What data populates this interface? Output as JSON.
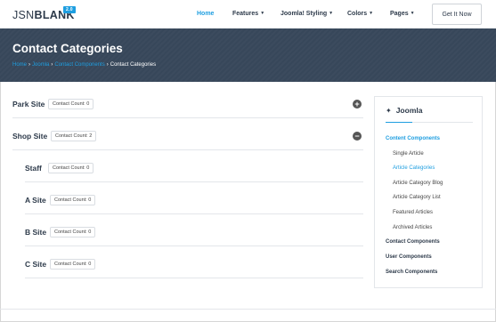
{
  "header": {
    "logo_main": "JSN",
    "logo_bold": "BLANK",
    "logo_version": "2.0",
    "nav": [
      {
        "label": "Home",
        "active": true,
        "has_caret": false
      },
      {
        "label": "Features",
        "active": false,
        "has_caret": true
      },
      {
        "label": "Joomla! Styling",
        "active": false,
        "has_caret": true
      },
      {
        "label": "Colors",
        "active": false,
        "has_caret": true
      },
      {
        "label": "Pages",
        "active": false,
        "has_caret": true
      }
    ],
    "cta_label": "Get It Now"
  },
  "banner": {
    "title": "Contact Categories",
    "breadcrumb": [
      {
        "label": "Home",
        "link": true
      },
      {
        "label": "Joomla",
        "link": true
      },
      {
        "label": "Contact Components",
        "link": true
      },
      {
        "label": "Contact Categories",
        "link": false
      }
    ]
  },
  "categories": [
    {
      "name": "Park Site",
      "count_label": "Contact Count:",
      "count": "0",
      "level": 0,
      "toggle": "plus"
    },
    {
      "name": "Shop Site",
      "count_label": "Contact Count:",
      "count": "2",
      "level": 0,
      "toggle": "minus"
    },
    {
      "name": "Staff",
      "count_label": "Contact Count:",
      "count": "0",
      "level": 1,
      "toggle": ""
    },
    {
      "name": "A Site",
      "count_label": "Contact Count:",
      "count": "0",
      "level": 1,
      "toggle": ""
    },
    {
      "name": "B Site",
      "count_label": "Contact Count:",
      "count": "0",
      "level": 1,
      "toggle": ""
    },
    {
      "name": "C Site",
      "count_label": "Contact Count:",
      "count": "0",
      "level": 1,
      "toggle": ""
    }
  ],
  "sidebar": {
    "title": "Joomla",
    "items": [
      {
        "label": "Content Components",
        "type": "group",
        "active": true
      },
      {
        "label": "Single Article",
        "type": "sub",
        "active": false
      },
      {
        "label": "Article Categories",
        "type": "sub",
        "active": true
      },
      {
        "label": "Article Category Blog",
        "type": "sub",
        "active": false
      },
      {
        "label": "Article Category List",
        "type": "sub",
        "active": false
      },
      {
        "label": "Featured Articles",
        "type": "sub",
        "active": false
      },
      {
        "label": "Archived Articles",
        "type": "sub",
        "active": false
      },
      {
        "label": "Contact Components",
        "type": "group",
        "active": false
      },
      {
        "label": "User Components",
        "type": "group",
        "active": false
      },
      {
        "label": "Search Components",
        "type": "group",
        "active": false
      }
    ]
  },
  "colors": {
    "accent": "#1e9ee0",
    "banner_bg": "#37475a",
    "dark_text": "#2d3a4a"
  }
}
